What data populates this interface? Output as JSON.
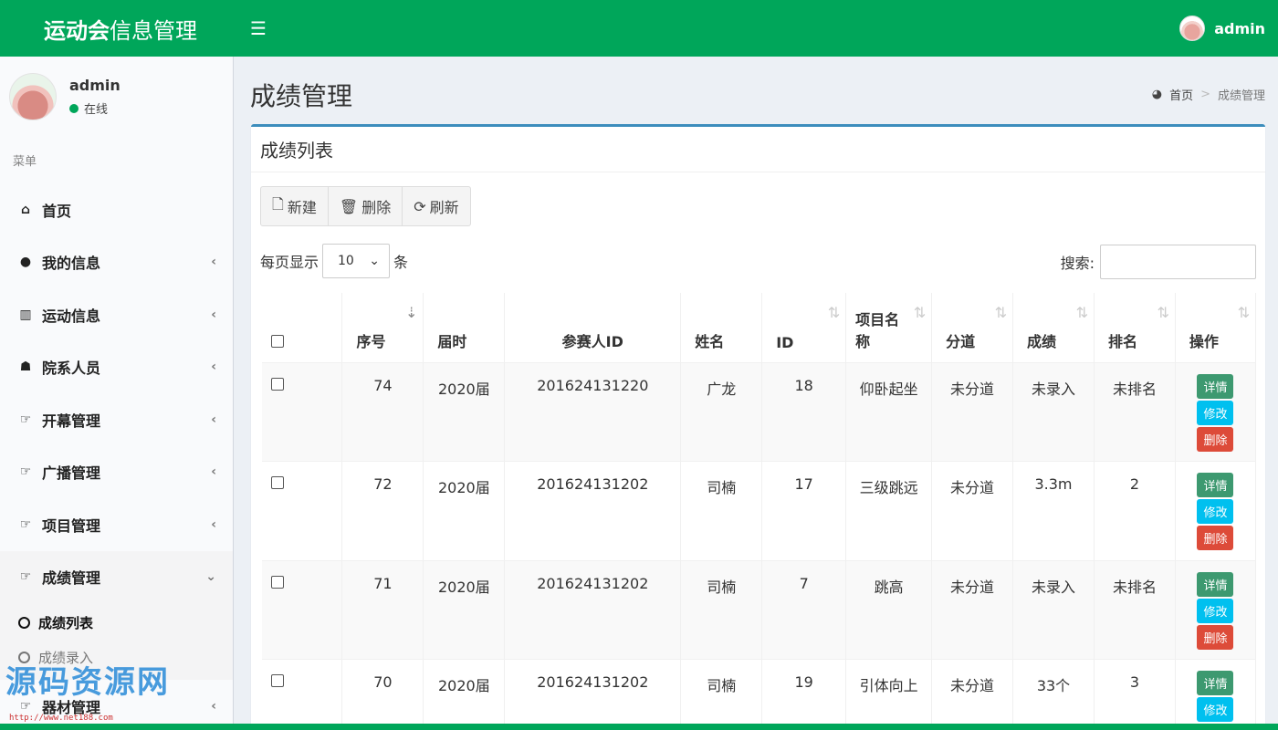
{
  "header": {
    "brand_bold": "运动会",
    "brand_rest": "信息管理",
    "menu_icon": "☰",
    "user_name": "admin"
  },
  "sidebar": {
    "user": {
      "name": "admin",
      "status": "在线"
    },
    "menu_header": "菜单",
    "items": [
      {
        "label": "首页",
        "icon": "home-icon"
      },
      {
        "label": "我的信息",
        "icon": "user-icon"
      },
      {
        "label": "运动信息",
        "icon": "bar-chart-icon"
      },
      {
        "label": "院系人员",
        "icon": "users-icon"
      },
      {
        "label": "开幕管理",
        "icon": "thumbs-up-icon"
      },
      {
        "label": "广播管理",
        "icon": "thumbs-up-icon"
      },
      {
        "label": "项目管理",
        "icon": "thumbs-up-icon"
      },
      {
        "label": "成绩管理",
        "icon": "thumbs-up-icon"
      },
      {
        "label": "器材管理",
        "icon": "thumbs-up-icon"
      }
    ],
    "sub_items": [
      {
        "label": "成绩列表"
      },
      {
        "label": "成绩录入"
      }
    ],
    "watermark": "源码资源网",
    "watermark_url": "http://www.net188.com"
  },
  "page": {
    "title": "成绩管理",
    "breadcrumb_home": "首页",
    "breadcrumb_current": "成绩管理"
  },
  "box": {
    "title": "成绩列表",
    "toolbar": {
      "new": "新建",
      "delete": "删除",
      "refresh": "刷新"
    },
    "length": {
      "prefix": "每页显示",
      "value": "10",
      "suffix": "条"
    },
    "search_label": "搜索:"
  },
  "table": {
    "headers": [
      "序号",
      "届时",
      "参赛人ID",
      "姓名",
      "ID",
      "项目名称",
      "分道",
      "成绩",
      "排名",
      "操作"
    ],
    "rows": [
      [
        "74",
        "2020届",
        "201624131220",
        "广龙",
        "18",
        "仰卧起坐",
        "未分道",
        "未录入",
        "未排名"
      ],
      [
        "72",
        "2020届",
        "201624131202",
        "司楠",
        "17",
        "三级跳远",
        "未分道",
        "3.3m",
        "2"
      ],
      [
        "71",
        "2020届",
        "201624131202",
        "司楠",
        "7",
        "跳高",
        "未分道",
        "未录入",
        "未排名"
      ],
      [
        "70",
        "2020届",
        "201624131202",
        "司楠",
        "19",
        "引体向上",
        "未分道",
        "33个",
        "3"
      ]
    ],
    "ops": {
      "detail": "详情",
      "edit": "修改",
      "delete": "删除"
    }
  },
  "colors": {
    "green": "#00a65a",
    "blue": "#3c8dbc",
    "detail": "#3d9970",
    "edit": "#00c0ef",
    "delete": "#dd4b39"
  }
}
